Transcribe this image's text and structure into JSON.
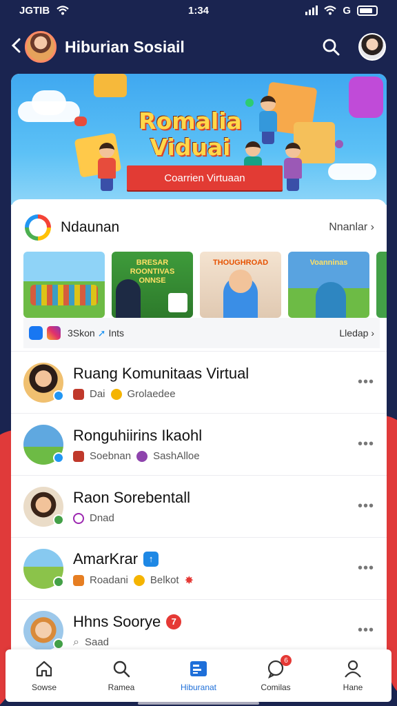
{
  "status_bar": {
    "carrier": "JGTIB",
    "time": "1:34",
    "network": "G"
  },
  "header": {
    "title": "Hiburian Sosiail"
  },
  "banner": {
    "title_line1": "Romalia",
    "title_line2": "Viduai",
    "ribbon": "Coarrien Virtuaan"
  },
  "section": {
    "title": "Ndaunan",
    "more": "Nnanlar",
    "thumbnails": [
      {
        "caption": "",
        "bg": "#6dbb45"
      },
      {
        "caption": "BRESAR ROONTIVAS ONNSE",
        "bg": "#3e9b3b"
      },
      {
        "caption": "THOUGHROAD",
        "bg": "#f4e3d0"
      },
      {
        "caption": "Voanninas",
        "bg": "#59a3e0"
      }
    ],
    "footer_text": "3Skon",
    "footer_text2": "Ints",
    "footer_more": "Lledap"
  },
  "chats": [
    {
      "name": "Ruang Komunitaas Virtual",
      "meta1": "Dai",
      "meta2": "Grolaedee",
      "name_badge": "",
      "colors": {
        "avatar": "#f0c070",
        "badge": "#2196f3",
        "m1": "#c0392b",
        "m2": "#f5b400"
      }
    },
    {
      "name": "Ronguhiirins Ikaohl",
      "meta1": "Soebnan",
      "meta2": "SashAlloe",
      "name_badge": "",
      "colors": {
        "avatar": "#5fa8e0",
        "badge": "#2196f3",
        "m1": "#c0392b",
        "m2": "#8e44ad"
      }
    },
    {
      "name": "Raon Sorebentall",
      "meta1": "Dnad",
      "meta2": "",
      "name_badge": "",
      "colors": {
        "avatar": "#eadcc8",
        "badge": "#43a047",
        "m1": "#9c27b0",
        "m2": ""
      }
    },
    {
      "name": "AmarKrar",
      "meta1": "Roadani",
      "meta2": "Belkot",
      "name_badge": "↑",
      "colors": {
        "avatar": "#8bc34a",
        "badge": "#43a047",
        "m1": "#e67e22",
        "m2": "#f5b400"
      }
    },
    {
      "name": "Hhns Soorye",
      "meta1": "Saad",
      "meta2": "",
      "name_badge": "7",
      "colors": {
        "avatar": "#9dc8ea",
        "badge": "#43a047",
        "m1": "#999999",
        "m2": ""
      }
    }
  ],
  "nav": [
    {
      "label": "Sowse",
      "icon": "home-icon"
    },
    {
      "label": "Ramea",
      "icon": "search-icon"
    },
    {
      "label": "Hiburanat",
      "icon": "feed-icon",
      "active": true
    },
    {
      "label": "Comilas",
      "icon": "chat-icon",
      "badge": "6"
    },
    {
      "label": "Hane",
      "icon": "profile-icon"
    }
  ],
  "colors": {
    "background": "#1a2450",
    "accent": "#1e6fd9",
    "red": "#e53935"
  }
}
